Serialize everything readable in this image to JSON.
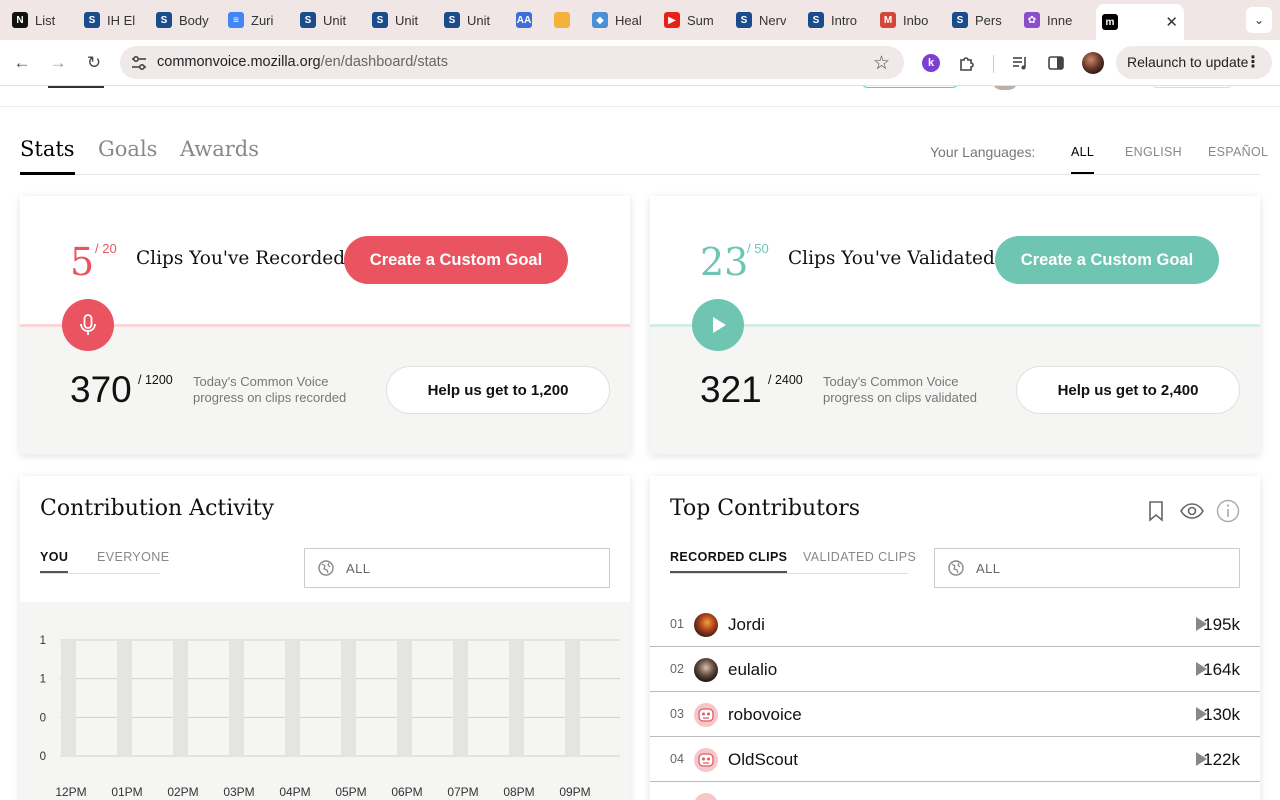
{
  "browser": {
    "tabs": [
      {
        "label": "List",
        "fav": "N",
        "favbg": "#111"
      },
      {
        "label": "IH El",
        "fav": "S",
        "favbg": "#1a4b8a"
      },
      {
        "label": "Body",
        "fav": "S",
        "favbg": "#1a4b8a"
      },
      {
        "label": "Zuri",
        "fav": "≡",
        "favbg": "#4285f4"
      },
      {
        "label": "Unit",
        "fav": "S",
        "favbg": "#1a4b8a"
      },
      {
        "label": "Unit",
        "fav": "S",
        "favbg": "#1a4b8a"
      },
      {
        "label": "Unit",
        "fav": "S",
        "favbg": "#1a4b8a"
      },
      {
        "label": "",
        "fav": "AA",
        "favbg": "#3c6fd8"
      },
      {
        "label": "",
        "fav": "",
        "favbg": "#f4b13c"
      },
      {
        "label": "Heal",
        "fav": "◆",
        "favbg": "#4a90d9"
      },
      {
        "label": "Sum",
        "fav": "▶",
        "favbg": "#e62117"
      },
      {
        "label": "Nerv",
        "fav": "S",
        "favbg": "#1a4b8a"
      },
      {
        "label": "Intro",
        "fav": "S",
        "favbg": "#1a4b8a"
      },
      {
        "label": "Inbo",
        "fav": "M",
        "favbg": "#d44638"
      },
      {
        "label": "Pers",
        "fav": "S",
        "favbg": "#1a4b8a"
      },
      {
        "label": "Inne",
        "fav": "✿",
        "favbg": "#8a4fc8"
      },
      {
        "label": "",
        "fav": "m",
        "favbg": "#000"
      }
    ],
    "url_host": "commonvoice.mozilla.org",
    "url_path": "/en/dashboard/stats",
    "relaunch": "Relaunch to update"
  },
  "page_tabs": [
    "Stats",
    "Goals",
    "Awards"
  ],
  "languages": {
    "label": "Your Languages:",
    "items": [
      "ALL",
      "ENGLISH",
      "ESPAÑOL"
    ]
  },
  "recorded": {
    "count": "5",
    "goal": "/ 20",
    "title": "Clips You've Recorded",
    "button": "Create a Custom Goal",
    "progress": "370",
    "progress_goal": "/ 1200",
    "desc": "Today's Common Voice progress on clips recorded",
    "help": "Help us get to 1,200",
    "color": "#ea5461"
  },
  "validated": {
    "count": "23",
    "goal": "/ 50",
    "title": "Clips You've Validated",
    "button": "Create a Custom Goal",
    "progress": "321",
    "progress_goal": "/ 2400",
    "desc": "Today's Common Voice progress on clips validated",
    "help": "Help us get to 2,400",
    "color": "#6ec5b2"
  },
  "activity": {
    "title": "Contribution Activity",
    "tabs": [
      "YOU",
      "EVERYONE"
    ],
    "select": "ALL",
    "chart_data": {
      "type": "bar",
      "categories": [
        "12PM",
        "01PM",
        "02PM",
        "03PM",
        "04PM",
        "05PM",
        "06PM",
        "07PM",
        "08PM",
        "09PM"
      ],
      "values": [
        0,
        0,
        0,
        0,
        0,
        0,
        0,
        0,
        0,
        0
      ],
      "yticks": [
        "1",
        "1",
        "0",
        "0"
      ],
      "grid": true
    }
  },
  "contributors": {
    "title": "Top Contributors",
    "tabs": [
      "RECORDED CLIPS",
      "VALIDATED CLIPS"
    ],
    "select": "ALL",
    "rows": [
      {
        "rank": "01",
        "name": "Jordi",
        "count": "195k"
      },
      {
        "rank": "02",
        "name": "eulalio",
        "count": "164k"
      },
      {
        "rank": "03",
        "name": "robovoice",
        "count": "130k"
      },
      {
        "rank": "04",
        "name": "OldScout",
        "count": "122k"
      }
    ]
  }
}
